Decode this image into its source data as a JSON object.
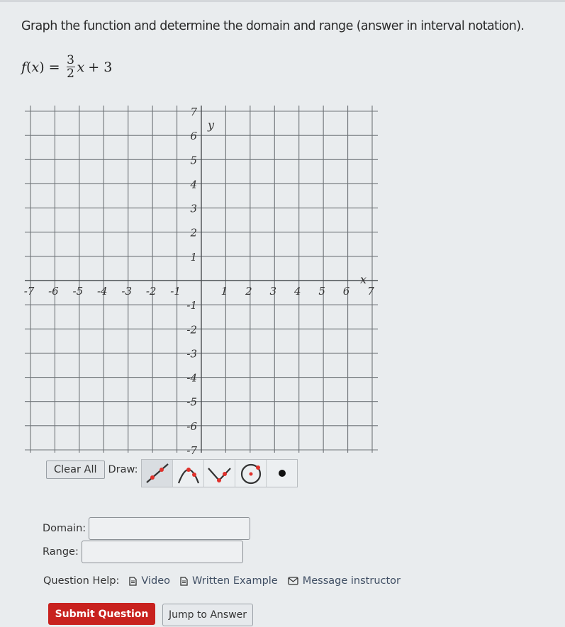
{
  "question": {
    "instruction": "Graph the function and determine the domain and range (answer in interval notation).",
    "function": {
      "lhs_name": "f",
      "lhs_var": "x",
      "equals": "=",
      "coef_num": "3",
      "coef_den": "2",
      "var": "x",
      "constant": "+ 3"
    }
  },
  "chart_data": {
    "type": "line",
    "title": "",
    "xlabel": "x",
    "ylabel": "y",
    "xlim": [
      -7,
      7
    ],
    "ylim": [
      -7,
      7
    ],
    "grid": true,
    "x_ticks": [
      "-7",
      "-6",
      "-5",
      "-4",
      "-3",
      "-2",
      "-1",
      "1",
      "2",
      "3",
      "4",
      "5",
      "6",
      "7"
    ],
    "y_ticks": [
      "7",
      "6",
      "5",
      "4",
      "3",
      "2",
      "1",
      "-1",
      "-2",
      "-3",
      "-4",
      "-5",
      "-6",
      "-7"
    ],
    "x_tick_values": [
      -7,
      -6,
      -5,
      -4,
      -3,
      -2,
      -1,
      1,
      2,
      3,
      4,
      5,
      6,
      7
    ],
    "y_tick_values": [
      7,
      6,
      5,
      4,
      3,
      2,
      1,
      -1,
      -2,
      -3,
      -4,
      -5,
      -6,
      -7
    ],
    "series": []
  },
  "toolbar": {
    "clear_all": "Clear All",
    "draw_label": "Draw:",
    "tools": [
      {
        "name": "line-tool",
        "icon": "line-icon",
        "active": true
      },
      {
        "name": "parabola-tool",
        "icon": "parabola-icon",
        "active": false
      },
      {
        "name": "absolute-value-tool",
        "icon": "absolute-value-icon",
        "active": false
      },
      {
        "name": "circle-tool",
        "icon": "circle-icon",
        "active": false
      },
      {
        "name": "point-tool",
        "icon": "point-icon",
        "active": false
      }
    ],
    "accent_color": "#e0312b"
  },
  "answers": {
    "domain_label": "Domain:",
    "domain_value": "",
    "range_label": "Range:",
    "range_value": ""
  },
  "help": {
    "label": "Question Help:",
    "video": "Video",
    "written_example": "Written Example",
    "message_instructor": "Message instructor"
  },
  "actions": {
    "submit": "Submit Question",
    "jump": "Jump to Answer",
    "submit_color": "#c8211e"
  }
}
